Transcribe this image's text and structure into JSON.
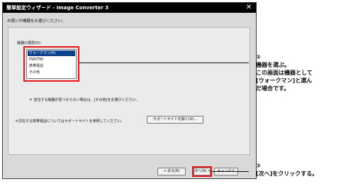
{
  "window": {
    "title": "簡単設定ウィザード - Image Converter 3",
    "close_glyph": "✕"
  },
  "intro_text": "お使いの機器をお選びください。",
  "device_list": {
    "label": "機器の選択(D):",
    "items": [
      {
        "label": "ウォークマン(R)",
        "selected": true
      },
      {
        "label": "PSP(TM)",
        "selected": false
      },
      {
        "label": "携帯電話",
        "selected": false
      },
      {
        "label": "その他",
        "selected": false
      }
    ]
  },
  "notes": {
    "note1": "＊ 該当する機器が見つからない場合は、[その他]をお選びください。",
    "note2": "＊対応する携帯電話についてはサポートサイトを参照してください。"
  },
  "buttons": {
    "support": "サポートサイトを開く(O)...",
    "back": "< 戻る(B)",
    "next": "次へ(N) >",
    "cancel": "キャンセル"
  },
  "annotations": {
    "step2_num": "②",
    "step2_lines": [
      "機器を選ぶ。",
      "この画面は機器として",
      "[ウォークマン]と選ん",
      "だ場合です。"
    ],
    "step3_num": "③",
    "step3_text": "[次へ]をクリックする。"
  },
  "colors": {
    "highlight_frame": "#e8151b",
    "selected_item": "#0b3f8a",
    "titlebar": "#000000"
  }
}
